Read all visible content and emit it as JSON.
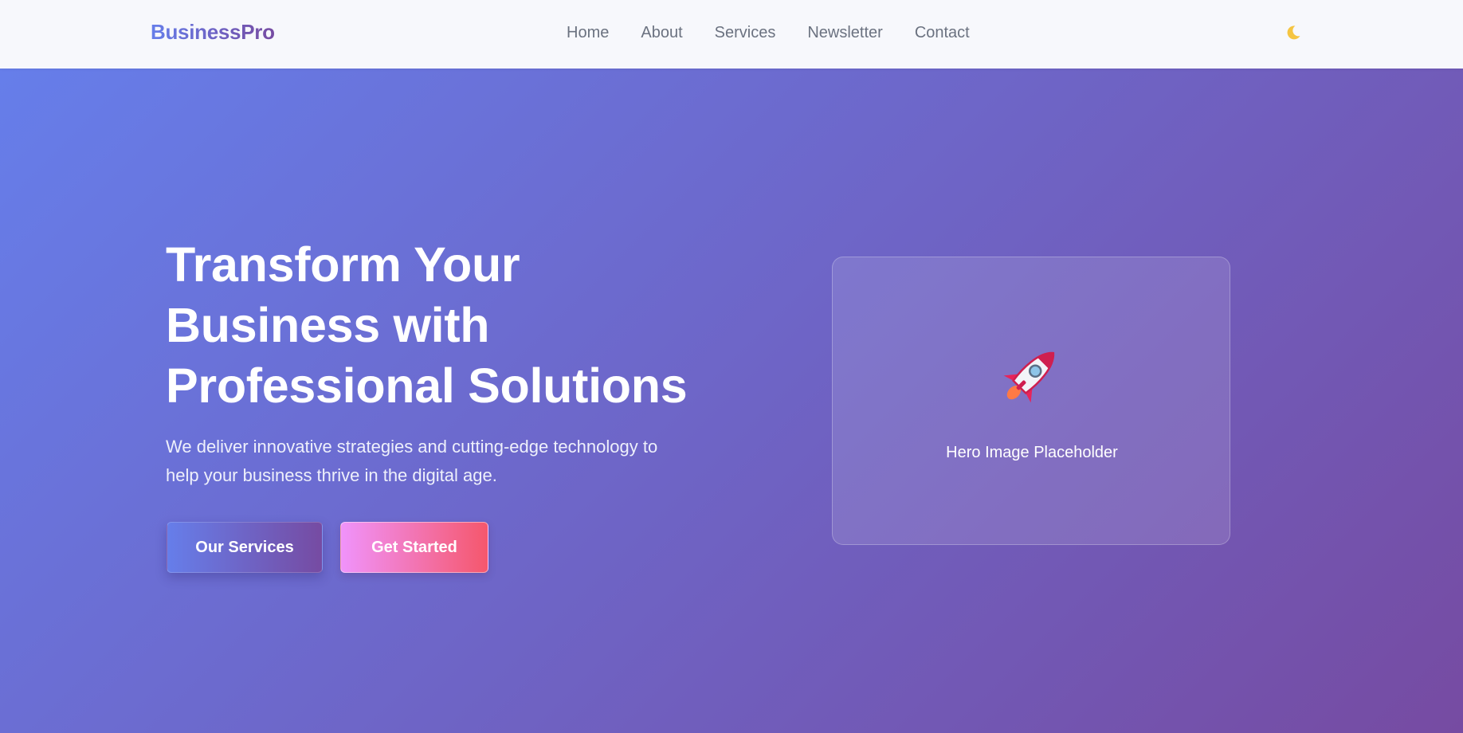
{
  "nav": {
    "brand": "BusinessPro",
    "links": [
      "Home",
      "About",
      "Services",
      "Newsletter",
      "Contact"
    ],
    "theme_toggle_icon": "moon-icon"
  },
  "hero": {
    "title_lines": [
      "Transform Your",
      "Business with",
      "Professional Solutions"
    ],
    "subtitle": "We deliver innovative strategies and cutting-edge technology to help your business thrive in the digital age.",
    "primary_button": "Our Services",
    "secondary_button": "Get Started",
    "image_caption": "Hero Image Placeholder",
    "image_icon": "rocket-icon"
  },
  "colors": {
    "gradient_start": "#667eea",
    "gradient_end": "#764ba2",
    "cta_gradient_start": "#f093fb",
    "cta_gradient_end": "#f5576c",
    "moon": "#f5c542"
  }
}
